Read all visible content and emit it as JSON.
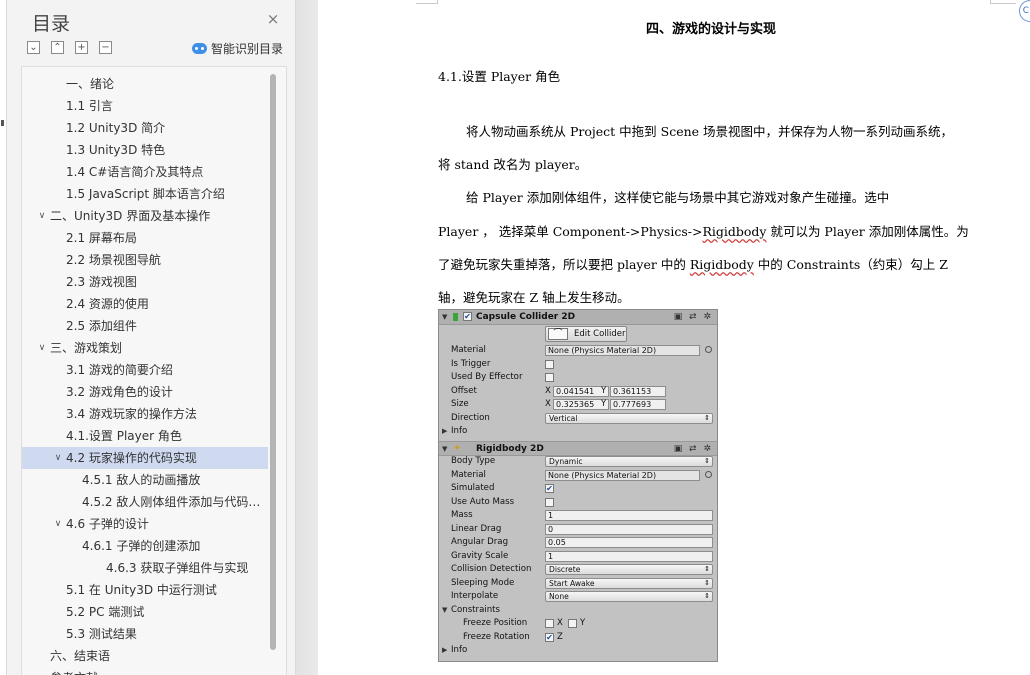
{
  "nav": {
    "title": "目录",
    "close_symbol": "×",
    "controls": [
      "⌄",
      "⌃",
      "+",
      "−"
    ],
    "smart_toc_label": "智能识别目录",
    "toc_items": [
      {
        "label": "一、绪论",
        "indent": 1,
        "chevron": ""
      },
      {
        "label": "1.1 引言",
        "indent": 1,
        "chevron": ""
      },
      {
        "label": "1.2 Unity3D 简介",
        "indent": 1,
        "chevron": ""
      },
      {
        "label": "1.3 Unity3D 特色",
        "indent": 1,
        "chevron": ""
      },
      {
        "label": "1.4 C#语言简介及其特点",
        "indent": 1,
        "chevron": ""
      },
      {
        "label": "1.5 JavaScript 脚本语言介绍",
        "indent": 1,
        "chevron": ""
      },
      {
        "label": "二、Unity3D 界面及基本操作",
        "indent": 0,
        "chevron": "expanded"
      },
      {
        "label": "2.1 屏幕布局",
        "indent": 1,
        "chevron": ""
      },
      {
        "label": "2.2 场景视图导航",
        "indent": 1,
        "chevron": ""
      },
      {
        "label": "2.3 游戏视图",
        "indent": 1,
        "chevron": ""
      },
      {
        "label": "2.4 资源的使用",
        "indent": 1,
        "chevron": ""
      },
      {
        "label": "2.5 添加组件",
        "indent": 1,
        "chevron": ""
      },
      {
        "label": "三、游戏策划",
        "indent": 0,
        "chevron": "expanded"
      },
      {
        "label": "3.1 游戏的简要介绍",
        "indent": 1,
        "chevron": ""
      },
      {
        "label": "3.2 游戏角色的设计",
        "indent": 1,
        "chevron": ""
      },
      {
        "label": "3.4 游戏玩家的操作方法",
        "indent": 1,
        "chevron": ""
      },
      {
        "label": "4.1.设置 Player 角色",
        "indent": 1,
        "chevron": ""
      },
      {
        "label": "4.2 玩家操作的代码实现",
        "indent": 1,
        "chevron": "expanded",
        "selected": true
      },
      {
        "label": "4.5.1 敌人的动画播放",
        "indent": 2,
        "chevron": ""
      },
      {
        "label": "4.5.2 敌人刚体组件添加与代码…",
        "indent": 2,
        "chevron": ""
      },
      {
        "label": "4.6 子弹的设计",
        "indent": 1,
        "chevron": "expanded"
      },
      {
        "label": "4.6.1 子弹的创建添加",
        "indent": 2,
        "chevron": ""
      },
      {
        "label": "4.6.3 获取子弹组件与实现",
        "indent": 3,
        "chevron": ""
      },
      {
        "label": "5.1 在 Unity3D 中运行测试",
        "indent": 1,
        "chevron": ""
      },
      {
        "label": "5.2 PC 端测试",
        "indent": 1,
        "chevron": ""
      },
      {
        "label": "5.3 测试结果",
        "indent": 1,
        "chevron": ""
      },
      {
        "label": "六、结束语",
        "indent": 0,
        "chevron": ""
      },
      {
        "label": "参考文献",
        "indent": 0,
        "chevron": ""
      }
    ]
  },
  "doc": {
    "heading": "四、游戏的设计与实现",
    "subheading": "4.1.设置 Player 角色",
    "p1_line1": "将人物动画系统从 Project 中拖到 Scene 场景视图中，并保存为人物一系列动画系统，",
    "p1_line2": "将 stand 改名为 player。",
    "p2_line1": "给 Player  添加刚体组件，这样使它能与场景中其它游戏对象产生碰撞。选中",
    "p2_line2_a": "Player  ，  选择菜单 Component->Physics->",
    "p2_line2_squig": "Rigidbody",
    "p2_line2_b": " 就可以为 Player 添加刚体属性。为",
    "p2_line3_a": "了避免玩家失重掉落，所以要把 player 中的 ",
    "p2_line3_squig": "Rigidbody",
    "p2_line3_b": " 中的 Constraints（约束）勾上 Z",
    "p2_line4": "轴，避免玩家在 Z 轴上发生移动。"
  },
  "inspector": {
    "collider": {
      "title": "Capsule Collider 2D",
      "edit_button": "Edit Collider",
      "material_label": "Material",
      "material_value": "None (Physics Material 2D)",
      "is_trigger_label": "Is Trigger",
      "used_by_effector_label": "Used By Effector",
      "offset_label": "Offset",
      "offset_x": "0.041541",
      "offset_y": "0.361153",
      "size_label": "Size",
      "size_x": "0.325365",
      "size_y": "0.777693",
      "direction_label": "Direction",
      "direction_value": "Vertical",
      "info_label": "Info"
    },
    "rigidbody": {
      "title": "Rigidbody 2D",
      "body_type_label": "Body Type",
      "body_type_value": "Dynamic",
      "material_label": "Material",
      "material_value": "None (Physics Material 2D)",
      "simulated_label": "Simulated",
      "use_auto_mass_label": "Use Auto Mass",
      "mass_label": "Mass",
      "mass_value": "1",
      "linear_drag_label": "Linear Drag",
      "linear_drag_value": "0",
      "angular_drag_label": "Angular Drag",
      "angular_drag_value": "0.05",
      "gravity_scale_label": "Gravity Scale",
      "gravity_scale_value": "1",
      "collision_detection_label": "Collision Detection",
      "collision_detection_value": "Discrete",
      "sleeping_mode_label": "Sleeping Mode",
      "sleeping_mode_value": "Start Awake",
      "interpolate_label": "Interpolate",
      "interpolate_value": "None",
      "constraints_label": "Constraints",
      "freeze_position_label": "Freeze Position",
      "freeze_rotation_label": "Freeze Rotation",
      "axis_x": "X",
      "axis_y": "Y",
      "axis_z": "Z",
      "info_label": "Info"
    },
    "axis_x_label": "X",
    "axis_y_label": "Y",
    "check_mark": "✔"
  },
  "colors": {
    "selected_row": "#cfdaf0",
    "accent_blue": "#3f8fe8",
    "squiggle": "#d04040"
  }
}
